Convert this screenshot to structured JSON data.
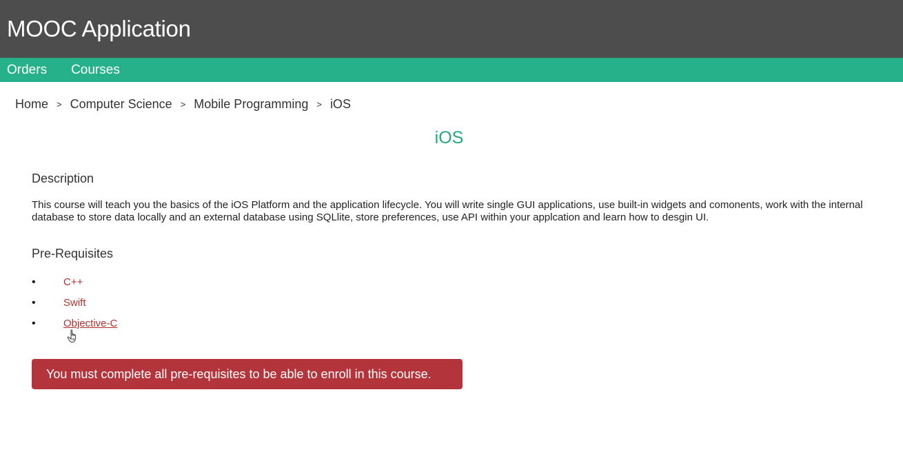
{
  "header": {
    "title": "MOOC Application"
  },
  "nav": {
    "items": [
      {
        "label": "Orders"
      },
      {
        "label": "Courses"
      }
    ]
  },
  "breadcrumb": {
    "separator": ">",
    "items": [
      {
        "label": "Home"
      },
      {
        "label": "Computer Science"
      },
      {
        "label": "Mobile Programming"
      },
      {
        "label": "iOS"
      }
    ]
  },
  "course": {
    "title": "iOS",
    "description_heading": "Description",
    "description": "This course will teach you the basics of the iOS Platform and the application lifecycle. You will write single GUI applications, use built-in widgets and comonents, work with the internal database to store data locally and an external database using SQLlite, store preferences, use API within your applcation and learn how to desgin UI.",
    "prereq_heading": "Pre-Requisites",
    "prerequisites": [
      {
        "label": "C++"
      },
      {
        "label": "Swift"
      },
      {
        "label": "Objective-C"
      }
    ],
    "enroll_alert": "You must complete all pre-requisites to be able to enroll in this course."
  },
  "icons": {
    "cursor": "hand-pointer-icon"
  },
  "colors": {
    "header_bg": "#4d4d4d",
    "nav_bg": "#26b18b",
    "title": "#26a581",
    "link": "#b0302e",
    "alert_bg": "#b3343b"
  }
}
